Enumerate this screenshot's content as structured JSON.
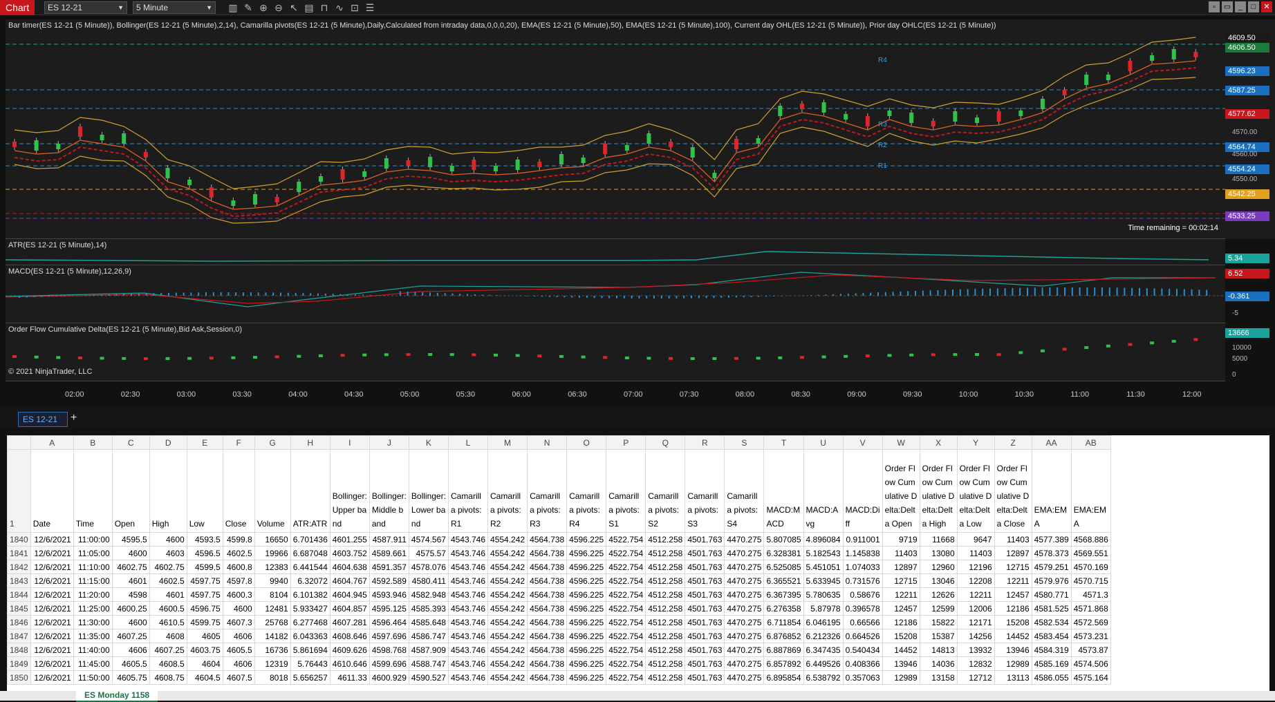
{
  "toolbar": {
    "chart_label": "Chart",
    "instrument": "ES 12-21",
    "interval": "5 Minute"
  },
  "panels": {
    "price_title": "Bar timer(ES 12-21 (5 Minute)), Bollinger(ES 12-21 (5 Minute),2,14), Camarilla pivots(ES 12-21 (5 Minute),Daily,Calculated from intraday data,0,0,0,20), EMA(ES 12-21 (5 Minute),50), EMA(ES 12-21 (5 Minute),100), Current day OHL(ES 12-21 (5 Minute)), Prior day OHLC(ES 12-21 (5 Minute))",
    "atr_title": "ATR(ES 12-21 (5 Minute),14)",
    "macd_title": "MACD(ES 12-21 (5 Minute),12,26,9)",
    "ofd_title": "Order Flow Cumulative Delta(ES 12-21 (5 Minute),Bid Ask,Session,0)",
    "copyright": "© 2021 NinjaTrader, LLC",
    "time_remaining": "Time remaining = 00:02:14",
    "pivot_labels": [
      "R4",
      "R3",
      "R2",
      "R1"
    ]
  },
  "price_levels": [
    {
      "v": "4609.50",
      "c": "#1a1a1a"
    },
    {
      "v": "4606.50",
      "c": "#1e7a3a"
    },
    {
      "v": "4596.23",
      "c": "#1b6fbf"
    },
    {
      "v": "4587.25",
      "c": "#1b6fbf"
    },
    {
      "v": "4577.62",
      "c": "#c8161d"
    },
    {
      "v": "4564.74",
      "c": "#1b6fbf"
    },
    {
      "v": "4554.24",
      "c": "#1b6fbf"
    },
    {
      "v": "4542.25",
      "c": "#e0a020"
    },
    {
      "v": "4533.25",
      "c": "#7b3bbf"
    }
  ],
  "price_ticks": [
    "4570.00",
    "4560.00",
    "4550.00"
  ],
  "atr_value": "5.34",
  "macd_values": [
    "6.52",
    "-0.361"
  ],
  "macd_ticks": [
    "-5"
  ],
  "ofd_value": "13666",
  "ofd_ticks": [
    "10000",
    "5000",
    "0"
  ],
  "x_labels": [
    "02:00",
    "02:30",
    "03:00",
    "03:30",
    "04:00",
    "04:30",
    "05:00",
    "05:30",
    "06:00",
    "06:30",
    "07:00",
    "07:30",
    "08:00",
    "08:30",
    "09:00",
    "09:30",
    "10:00",
    "10:30",
    "11:00",
    "11:30",
    "12:00"
  ],
  "tab": "ES 12-21",
  "sheet": {
    "cols": [
      "A",
      "B",
      "C",
      "D",
      "E",
      "F",
      "G",
      "H",
      "I",
      "J",
      "K",
      "L",
      "M",
      "N",
      "O",
      "P",
      "Q",
      "R",
      "S",
      "T",
      "U",
      "V",
      "W",
      "X",
      "Y",
      "Z",
      "AA",
      "AB"
    ],
    "headers": [
      "Date",
      "Time",
      "Open",
      "High",
      "Low",
      "Close",
      "Volume",
      "ATR:ATR",
      "Bollinger:Upper band",
      "Bollinger:Middle band",
      "Bollinger:Lower band",
      "Camarilla pivots:R1",
      "Camarilla pivots:R2",
      "Camarilla pivots:R3",
      "Camarilla pivots:R4",
      "Camarilla pivots:S1",
      "Camarilla pivots:S2",
      "Camarilla pivots:S3",
      "Camarilla pivots:S4",
      "MACD:MACD",
      "MACD:Avg",
      "MACD:Diff",
      "Order Flow Cumulative Delta:Delta Open",
      "Order Flow Cumulative Delta:Delta High",
      "Order Flow Cumulative Delta:Delta Low",
      "Order Flow Cumulative Delta:Delta Close",
      "EMA:EMA",
      "EMA:EMA"
    ],
    "rows": [
      [
        "1840",
        "12/6/2021",
        "11:00:00",
        "4595.5",
        "4600",
        "4593.5",
        "4599.8",
        "16650",
        "6.701436",
        "4601.255",
        "4587.911",
        "4574.567",
        "4543.746",
        "4554.242",
        "4564.738",
        "4596.225",
        "4522.754",
        "4512.258",
        "4501.763",
        "4470.275",
        "5.807085",
        "4.896084",
        "0.911001",
        "9719",
        "11668",
        "9647",
        "11403",
        "4577.389",
        "4568.886"
      ],
      [
        "1841",
        "12/6/2021",
        "11:05:00",
        "4600",
        "4603",
        "4596.5",
        "4602.5",
        "19966",
        "6.687048",
        "4603.752",
        "4589.661",
        "4575.57",
        "4543.746",
        "4554.242",
        "4564.738",
        "4596.225",
        "4522.754",
        "4512.258",
        "4501.763",
        "4470.275",
        "6.328381",
        "5.182543",
        "1.145838",
        "11403",
        "13080",
        "11403",
        "12897",
        "4578.373",
        "4569.551"
      ],
      [
        "1842",
        "12/6/2021",
        "11:10:00",
        "4602.75",
        "4602.75",
        "4599.5",
        "4600.8",
        "12383",
        "6.441544",
        "4604.638",
        "4591.357",
        "4578.076",
        "4543.746",
        "4554.242",
        "4564.738",
        "4596.225",
        "4522.754",
        "4512.258",
        "4501.763",
        "4470.275",
        "6.525085",
        "5.451051",
        "1.074033",
        "12897",
        "12960",
        "12196",
        "12715",
        "4579.251",
        "4570.169"
      ],
      [
        "1843",
        "12/6/2021",
        "11:15:00",
        "4601",
        "4602.5",
        "4597.75",
        "4597.8",
        "9940",
        "6.32072",
        "4604.767",
        "4592.589",
        "4580.411",
        "4543.746",
        "4554.242",
        "4564.738",
        "4596.225",
        "4522.754",
        "4512.258",
        "4501.763",
        "4470.275",
        "6.365521",
        "5.633945",
        "0.731576",
        "12715",
        "13046",
        "12208",
        "12211",
        "4579.976",
        "4570.715"
      ],
      [
        "1844",
        "12/6/2021",
        "11:20:00",
        "4598",
        "4601",
        "4597.75",
        "4600.3",
        "8104",
        "6.101382",
        "4604.945",
        "4593.946",
        "4582.948",
        "4543.746",
        "4554.242",
        "4564.738",
        "4596.225",
        "4522.754",
        "4512.258",
        "4501.763",
        "4470.275",
        "6.367395",
        "5.780635",
        "0.58676",
        "12211",
        "12626",
        "12211",
        "12457",
        "4580.771",
        "4571.3"
      ],
      [
        "1845",
        "12/6/2021",
        "11:25:00",
        "4600.25",
        "4600.5",
        "4596.75",
        "4600",
        "12481",
        "5.933427",
        "4604.857",
        "4595.125",
        "4585.393",
        "4543.746",
        "4554.242",
        "4564.738",
        "4596.225",
        "4522.754",
        "4512.258",
        "4501.763",
        "4470.275",
        "6.276358",
        "5.87978",
        "0.396578",
        "12457",
        "12599",
        "12006",
        "12186",
        "4581.525",
        "4571.868"
      ],
      [
        "1846",
        "12/6/2021",
        "11:30:00",
        "4600",
        "4610.5",
        "4599.75",
        "4607.3",
        "25768",
        "6.277468",
        "4607.281",
        "4596.464",
        "4585.648",
        "4543.746",
        "4554.242",
        "4564.738",
        "4596.225",
        "4522.754",
        "4512.258",
        "4501.763",
        "4470.275",
        "6.711854",
        "6.046195",
        "0.66566",
        "12186",
        "15822",
        "12171",
        "15208",
        "4582.534",
        "4572.569"
      ],
      [
        "1847",
        "12/6/2021",
        "11:35:00",
        "4607.25",
        "4608",
        "4605",
        "4606",
        "14182",
        "6.043363",
        "4608.646",
        "4597.696",
        "4586.747",
        "4543.746",
        "4554.242",
        "4564.738",
        "4596.225",
        "4522.754",
        "4512.258",
        "4501.763",
        "4470.275",
        "6.876852",
        "6.212326",
        "0.664526",
        "15208",
        "15387",
        "14256",
        "14452",
        "4583.454",
        "4573.231"
      ],
      [
        "1848",
        "12/6/2021",
        "11:40:00",
        "4606",
        "4607.25",
        "4603.75",
        "4605.5",
        "16736",
        "5.861694",
        "4609.626",
        "4598.768",
        "4587.909",
        "4543.746",
        "4554.242",
        "4564.738",
        "4596.225",
        "4522.754",
        "4512.258",
        "4501.763",
        "4470.275",
        "6.887869",
        "6.347435",
        "0.540434",
        "14452",
        "14813",
        "13932",
        "13946",
        "4584.319",
        "4573.87"
      ],
      [
        "1849",
        "12/6/2021",
        "11:45:00",
        "4605.5",
        "4608.5",
        "4604",
        "4606",
        "12319",
        "5.76443",
        "4610.646",
        "4599.696",
        "4588.747",
        "4543.746",
        "4554.242",
        "4564.738",
        "4596.225",
        "4522.754",
        "4512.258",
        "4501.763",
        "4470.275",
        "6.857892",
        "6.449526",
        "0.408366",
        "13946",
        "14036",
        "12832",
        "12989",
        "4585.169",
        "4574.506"
      ],
      [
        "1850",
        "12/6/2021",
        "11:50:00",
        "4605.75",
        "4608.75",
        "4604.5",
        "4607.5",
        "8018",
        "5.656257",
        "4611.33",
        "4600.929",
        "4590.527",
        "4543.746",
        "4554.242",
        "4564.738",
        "4596.225",
        "4522.754",
        "4512.258",
        "4501.763",
        "4470.275",
        "6.895854",
        "6.538792",
        "0.357063",
        "12989",
        "13158",
        "12712",
        "13113",
        "4586.055",
        "4575.164"
      ]
    ]
  },
  "sheet_tab": "ES Monday 1158"
}
